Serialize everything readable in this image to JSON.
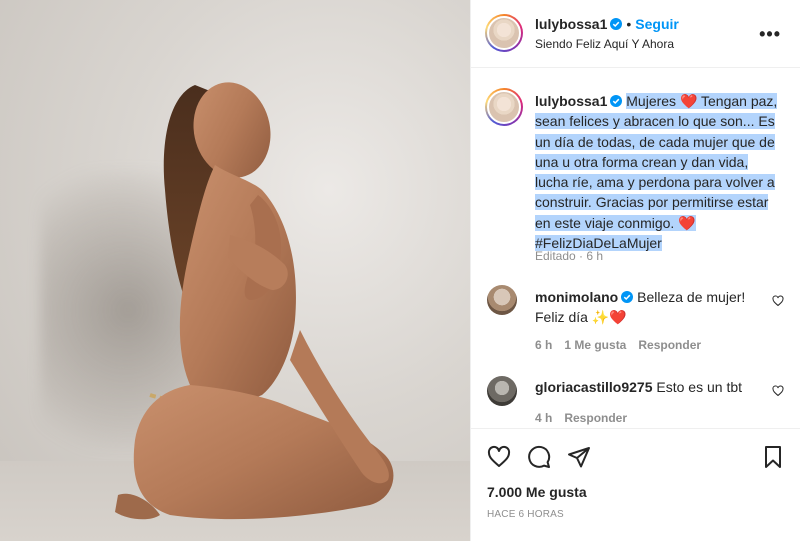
{
  "post": {
    "photo_alt": "Mujer sentada de rodillas junto a una pared",
    "author": {
      "username": "lulybossa1",
      "verified": true,
      "follow_label": "Seguir",
      "location": "Siendo Feliz Aquí Y Ahora"
    },
    "caption": {
      "username": "lulybossa1",
      "lines": [
        "Mujeres ❤️ Tengan paz,",
        "sean felices y abracen lo que son... Es",
        "un día de todas, de cada mujer que de",
        "una u otra forma crean y dan vida,",
        "lucha ríe, ama y perdona para volver a",
        "construir. Gracias por permitirse estar",
        "en este viaje conmigo. ❤️",
        "#FelizDiaDeLaMujer"
      ],
      "meta": "Editado · 6 h"
    },
    "comments": [
      {
        "username": "monimolano",
        "verified": true,
        "text_line1": "Belleza de mujer!",
        "text_line2": "Feliz día ✨❤️",
        "age": "6 h",
        "likes": "1 Me gusta",
        "reply": "Responder"
      },
      {
        "username": "gloriacastillo9275",
        "verified": false,
        "text_line1": "Esto es un tbt",
        "age": "4 h",
        "reply": "Responder"
      }
    ],
    "likes_text": "7.000 Me gusta",
    "time_text": "HACE 6 HORAS",
    "more_icon": "more-horizontal-icon",
    "colors": {
      "accent": "#0095f6",
      "text": "#262626",
      "muted": "#8e8e8e",
      "selection": "#b3d4fc",
      "heart": "#ed4956"
    }
  }
}
